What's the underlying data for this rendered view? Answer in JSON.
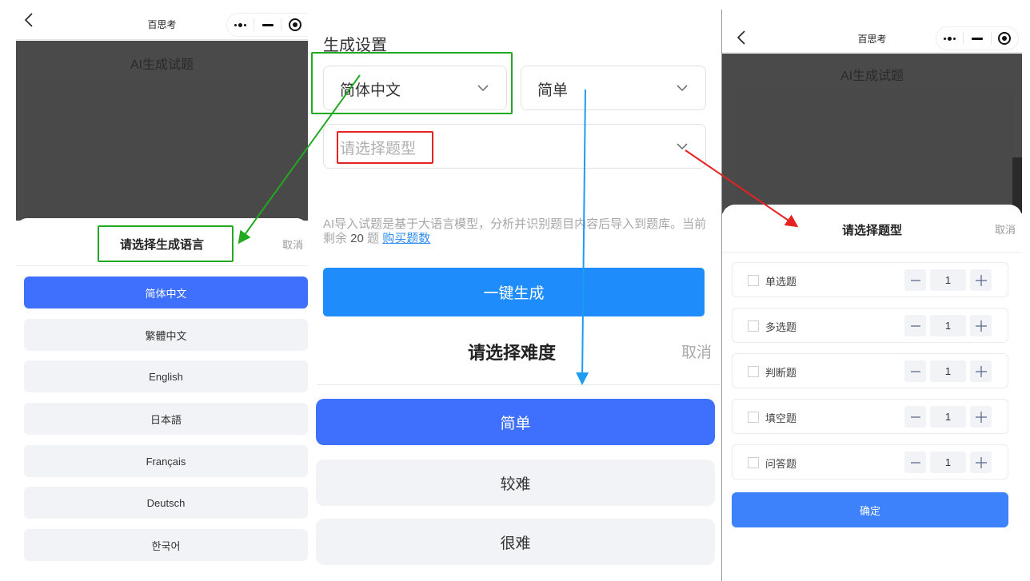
{
  "left_panel": {
    "navbar": {
      "title": "百思考",
      "back_icon": "chevron-left-icon",
      "more_icon": "more-dots-icon",
      "minimize_icon": "minimize-icon",
      "close_icon": "target-close-icon"
    },
    "page_title": "AI生成试题",
    "sheet": {
      "title": "请选择生成语言",
      "cancel": "取消",
      "options": [
        {
          "label": "简体中文",
          "selected": true
        },
        {
          "label": "繁體中文",
          "selected": false
        },
        {
          "label": "English",
          "selected": false
        },
        {
          "label": "日本語",
          "selected": false
        },
        {
          "label": "Français",
          "selected": false
        },
        {
          "label": "Deutsch",
          "selected": false
        },
        {
          "label": "한국어",
          "selected": false
        }
      ]
    }
  },
  "middle_panel": {
    "section_title": "生成设置",
    "language_select": {
      "value": "简体中文"
    },
    "difficulty_select": {
      "value": "简单"
    },
    "type_select": {
      "placeholder": "请选择题型"
    },
    "description": {
      "text_main": "AI导入试题是基于大语言模型，分析并识别题目内容后导入到题库。当前剩余 ",
      "remaining_count": "20",
      "text_unit": " 题 ",
      "buy_link": "购买题数"
    },
    "generate_button": "一键生成",
    "difficulty_sheet": {
      "title": "请选择难度",
      "cancel": "取消",
      "options": [
        {
          "label": "简单",
          "selected": true
        },
        {
          "label": "较难",
          "selected": false
        },
        {
          "label": "很难",
          "selected": false
        }
      ]
    }
  },
  "right_panel": {
    "navbar": {
      "title": "百思考"
    },
    "page_title": "AI生成试题",
    "type_sheet": {
      "title": "请选择题型",
      "cancel": "取消",
      "rows": [
        {
          "label": "单选题",
          "checked": false,
          "count": "1"
        },
        {
          "label": "多选题",
          "checked": false,
          "count": "1"
        },
        {
          "label": "判断题",
          "checked": false,
          "count": "1"
        },
        {
          "label": "填空题",
          "checked": false,
          "count": "1"
        },
        {
          "label": "问答题",
          "checked": false,
          "count": "1"
        }
      ],
      "confirm": "确定"
    }
  },
  "annotations": {
    "green": "#22a922",
    "red": "#e62222",
    "blue": "#1e9cf5"
  }
}
